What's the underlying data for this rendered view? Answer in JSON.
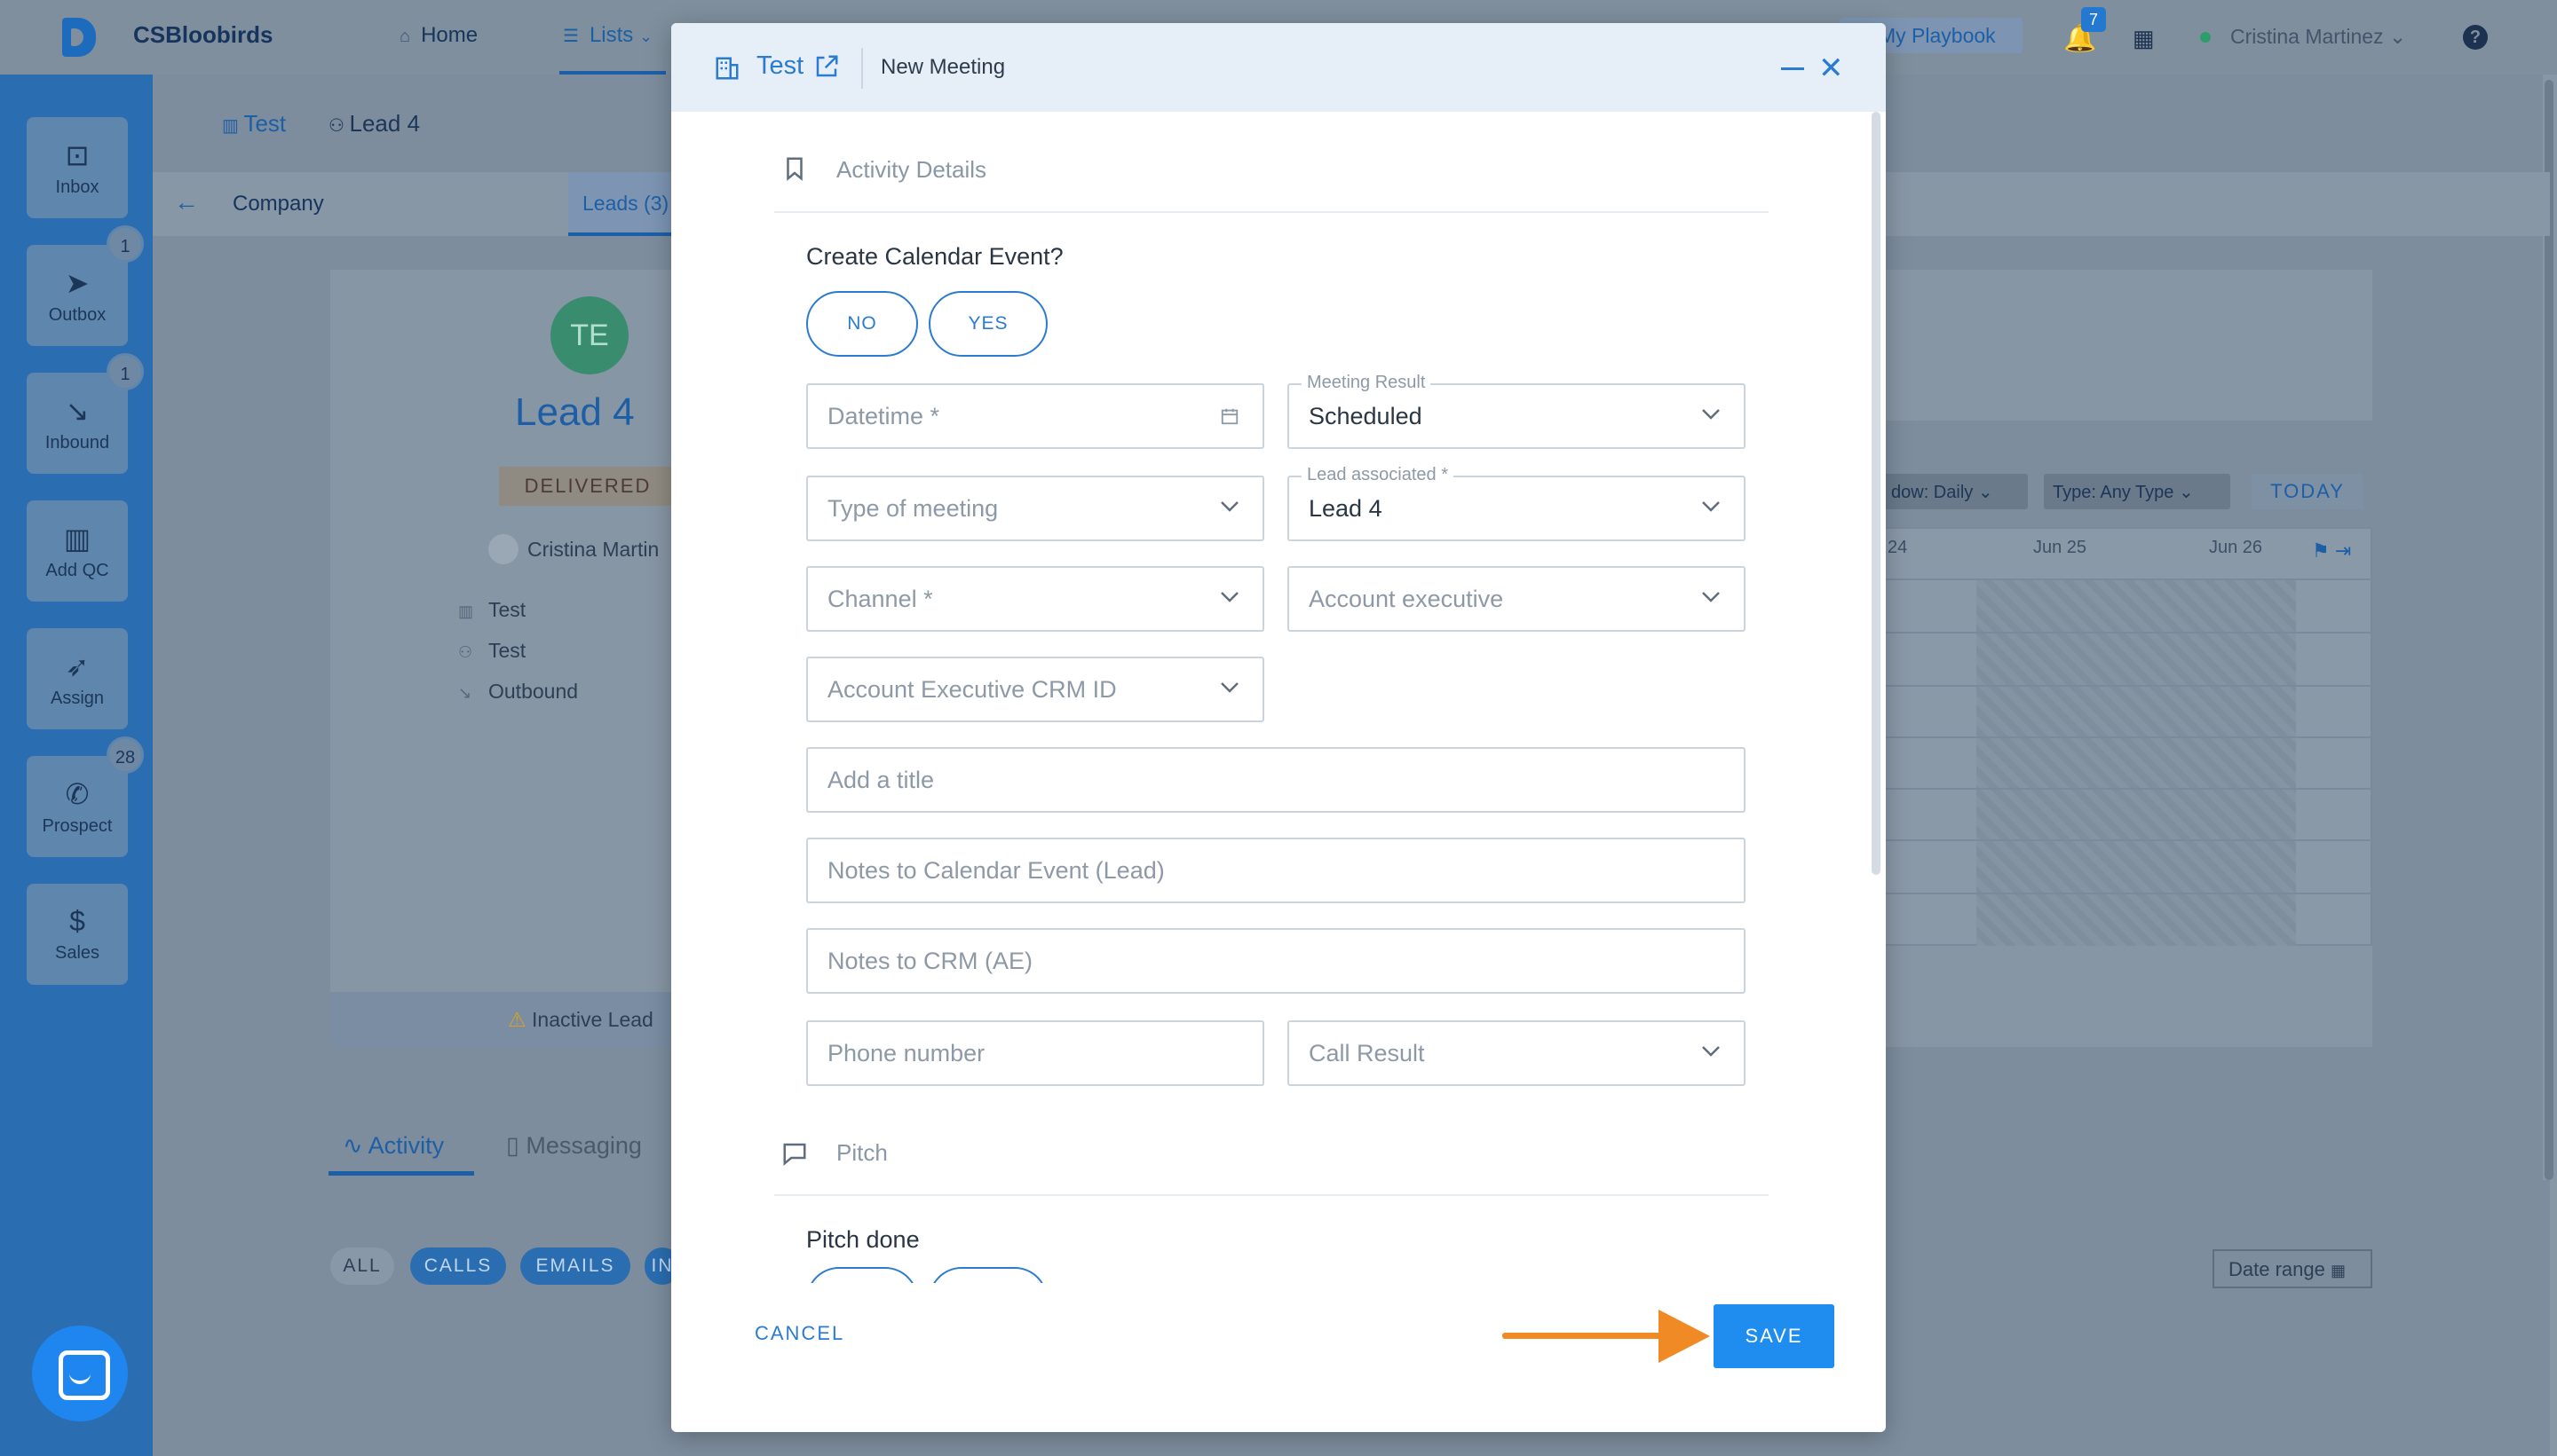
{
  "app": {
    "name": "CSBloobirds",
    "nav": [
      {
        "label": "Home",
        "icon": "home-icon"
      },
      {
        "label": "Lists",
        "icon": "list-icon"
      }
    ],
    "playbook_label": "My Playbook",
    "notifications_count": "7",
    "user_name": "Cristina Martinez",
    "accent_color": "#1f8cf0"
  },
  "sidebar": [
    {
      "label": "Inbox",
      "icon": "inbox-icon",
      "badge": ""
    },
    {
      "label": "Outbox",
      "icon": "send-icon",
      "badge": "1"
    },
    {
      "label": "Inbound",
      "icon": "arrow-down-right-icon",
      "badge": "1"
    },
    {
      "label": "Add QC",
      "icon": "building-icon",
      "badge": ""
    },
    {
      "label": "Assign",
      "icon": "navigation-icon",
      "badge": ""
    },
    {
      "label": "Prospect",
      "icon": "phone-icon",
      "badge": "28"
    },
    {
      "label": "Sales",
      "icon": "dollar-icon",
      "badge": ""
    }
  ],
  "breadcrumb": {
    "company": "Test",
    "lead": "Lead 4"
  },
  "tabs": {
    "company": "Company",
    "leads": "Leads (3)"
  },
  "lead_card": {
    "initials": "TE",
    "name": "Lead 4",
    "status": "DELIVERED",
    "owner": "Cristina Martin",
    "info": [
      "Test",
      "Test",
      "Outbound"
    ],
    "inactive": "Inactive Lead"
  },
  "activity_tabs": {
    "activity": "Activity",
    "messaging": "Messaging"
  },
  "filters": {
    "all": "ALL",
    "calls": "CALLS",
    "emails": "EMAILS",
    "in": "IN",
    "date_range": "Date range"
  },
  "calendar": {
    "view_filter": "dow: Daily",
    "type_filter": "Type: Any Type",
    "today": "TODAY",
    "days": [
      "24",
      "Jun 25",
      "Jun 26"
    ]
  },
  "modal": {
    "company": "Test",
    "title": "New Meeting",
    "section_activity": "Activity Details",
    "create_event_question": "Create Calendar Event?",
    "no": "NO",
    "yes": "YES",
    "fields": {
      "datetime": {
        "placeholder": "Datetime *"
      },
      "meeting_result": {
        "label": "Meeting Result",
        "value": "Scheduled"
      },
      "type_of_meeting": {
        "placeholder": "Type of meeting"
      },
      "lead_associated": {
        "label": "Lead associated *",
        "value": "Lead 4"
      },
      "channel": {
        "placeholder": "Channel *"
      },
      "account_executive": {
        "placeholder": "Account executive"
      },
      "ae_crm_id": {
        "placeholder": "Account Executive CRM ID"
      },
      "title": {
        "placeholder": "Add a title"
      },
      "notes_lead": {
        "placeholder": "Notes to Calendar Event (Lead)"
      },
      "notes_crm": {
        "placeholder": "Notes to CRM (AE)"
      },
      "phone": {
        "placeholder": "Phone number"
      },
      "call_result": {
        "placeholder": "Call Result"
      }
    },
    "section_pitch": "Pitch",
    "pitch_done": "Pitch done",
    "cancel": "CANCEL",
    "save": "SAVE"
  },
  "annotation": {
    "arrow_color": "#f08a24"
  }
}
